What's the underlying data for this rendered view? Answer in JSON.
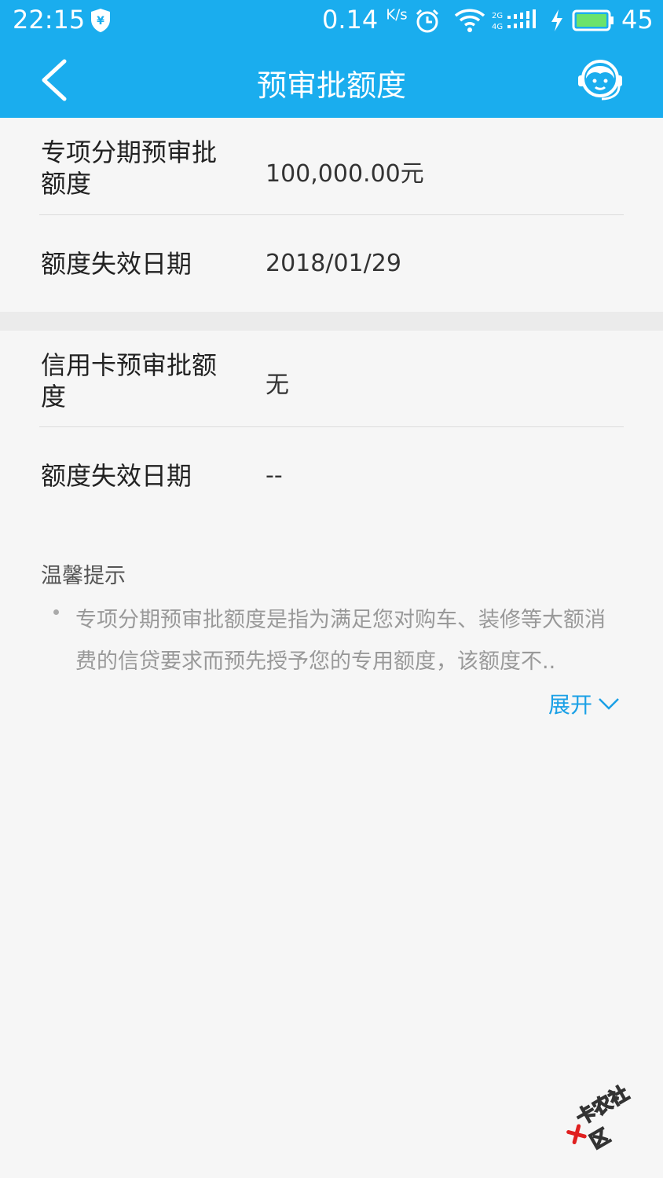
{
  "status_bar": {
    "time": "22:15",
    "net_speed": "0.14",
    "net_unit": "K/s",
    "battery_level": "45",
    "icons": [
      "shield-yen-icon",
      "alarm-icon",
      "wifi-icon",
      "signal-icon",
      "charging-icon",
      "battery-icon"
    ]
  },
  "header": {
    "title": "预审批额度",
    "back_icon": "back-arrow-icon",
    "service_icon": "customer-service-icon"
  },
  "sections": [
    {
      "rows": [
        {
          "label": "专项分期预审批额度",
          "value": "100,000.00元"
        },
        {
          "label": "额度失效日期",
          "value": "2018/01/29"
        }
      ]
    },
    {
      "rows": [
        {
          "label": "信用卡预审批额度",
          "value": "无"
        },
        {
          "label": "额度失效日期",
          "value": "--"
        }
      ]
    }
  ],
  "tips": {
    "title": "温馨提示",
    "text": "专项分期预审批额度是指为满足您对购车、装修等大额消费的信贷要求而预先授予您的专用额度，该额度不..",
    "expand_label": "展开"
  },
  "watermark": {
    "text": "卡农社区"
  },
  "colors": {
    "header_bg": "#1aadee",
    "page_bg": "#f6f6f6",
    "link": "#1aa0e6"
  }
}
